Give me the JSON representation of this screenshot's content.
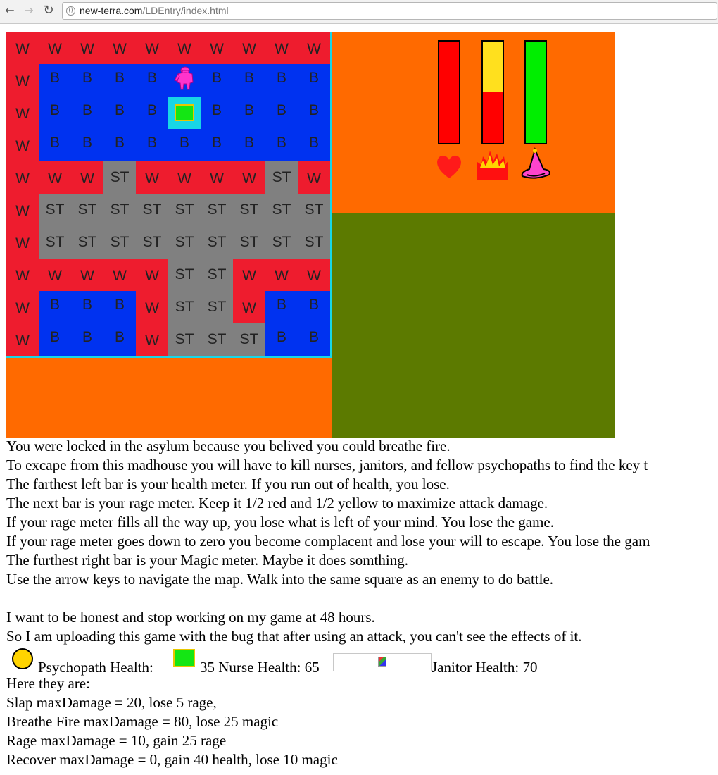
{
  "browser": {
    "back_icon": "back-arrow-icon",
    "forward_icon": "forward-arrow-icon",
    "reload_icon": "reload-icon",
    "url_host": "new-terra.com",
    "url_path": "/LDEntry/index.html"
  },
  "colors": {
    "wall": "#ee1c2e",
    "bed": "#0032f0",
    "stairs": "#808080",
    "panel_orange": "#ff6a00",
    "panel_green": "#5c7a00",
    "highlight": "#18d6e6"
  },
  "map": {
    "rows": [
      [
        "W",
        "W",
        "W",
        "W",
        "W",
        "W",
        "W",
        "W",
        "W",
        "W"
      ],
      [
        "W",
        "B",
        "B",
        "B",
        "B",
        "",
        "B",
        "B",
        "B",
        "B"
      ],
      [
        "W",
        "B",
        "B",
        "B",
        "B",
        "",
        "B",
        "B",
        "B",
        "B"
      ],
      [
        "W",
        "B",
        "B",
        "B",
        "B",
        "B",
        "B",
        "B",
        "B",
        "B"
      ],
      [
        "W",
        "W",
        "W",
        "ST",
        "W",
        "W",
        "W",
        "W",
        "ST",
        "W"
      ],
      [
        "W",
        "ST",
        "ST",
        "ST",
        "ST",
        "ST",
        "ST",
        "ST",
        "ST",
        "ST"
      ],
      [
        "W",
        "ST",
        "ST",
        "ST",
        "ST",
        "ST",
        "ST",
        "ST",
        "ST",
        "ST"
      ],
      [
        "W",
        "W",
        "W",
        "W",
        "W",
        "ST",
        "ST",
        "W",
        "W",
        "W"
      ],
      [
        "W",
        "B",
        "B",
        "B",
        "W",
        "ST",
        "ST",
        "W",
        "B",
        "B"
      ],
      [
        "W",
        "B",
        "B",
        "B",
        "W",
        "ST",
        "ST",
        "ST",
        "B",
        "B"
      ]
    ]
  },
  "meters": {
    "health": {
      "icon": "heart-icon",
      "fraction": 1.0,
      "fill": "#ff0000",
      "empty": "#ff0000"
    },
    "rage": {
      "icon": "fire-icon",
      "fraction": 0.5,
      "fill": "#ff0000",
      "empty": "#ffe01e"
    },
    "magic": {
      "icon": "magic-hat-icon",
      "fraction": 1.0,
      "fill": "#00ee00",
      "empty": "#00ee00"
    }
  },
  "text": {
    "lines": [
      "You were locked in the asylum because you belived you could breathe fire.",
      "To excape from this madhouse you will have to kill nurses, janitors, and fellow psychopaths to find the key t",
      "The farthest left bar is your health meter. If you run out of health, you lose.",
      "The next bar is your rage meter. Keep it 1/2 red and 1/2 yellow to maximize attack damage.",
      "If your rage meter fills all the way up, you lose what is left of your mind. You lose the game.",
      "If your rage meter goes down to zero you become complacent and lose your will to escape. You lose the gam",
      "The furthest right bar is your Magic meter. Maybe it does somthing.",
      "Use the arrow keys to navigate the map. Walk into the same square as an enemy to do battle."
    ],
    "honesty": [
      "I want to be honest and stop working on my game at 48 hours.",
      "So I am uploading this game with the bug that after using an attack, you can't see the effects of it."
    ],
    "enemies": {
      "psychopath": "Psychopath Health:",
      "nurse": "35 Nurse Health: 65",
      "janitor": "Janitor Health: 70"
    },
    "attacks_intro": "Here they are:",
    "attacks": [
      "Slap maxDamage = 20, lose 5 rage,",
      "Breathe Fire maxDamage = 80, lose 25 magic",
      "Rage maxDamage = 10, gain 25 rage",
      "Recover maxDamage = 0, gain 40 health, lose 10 magic"
    ]
  }
}
